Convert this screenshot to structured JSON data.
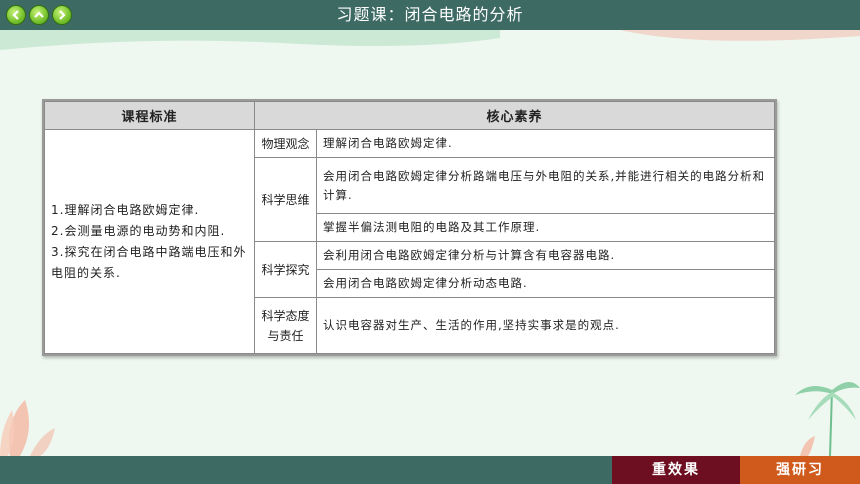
{
  "title": "习题课：闭合电路的分析",
  "colors": {
    "bar": "#3d6a63",
    "review": "#6d0f20",
    "train": "#cf5a1c",
    "nav": "#7bc531"
  },
  "table": {
    "headers": {
      "standard": "课程标准",
      "literacy": "核心素养"
    },
    "standards": [
      "1.理解闭合电路欧姆定律.",
      "2.会测量电源的电动势和内阻.",
      "3.探究在闭合电路中路端电压和外电阻的关系."
    ],
    "rows": [
      {
        "category": "物理观念",
        "text": "理解闭合电路欧姆定律."
      },
      {
        "category": "科学思维",
        "text": "会用闭合电路欧姆定律分析路端电压与外电阻的关系,并能进行相关的电路分析和计算."
      },
      {
        "category": "",
        "text": "掌握半偏法测电阻的电路及其工作原理."
      },
      {
        "category": "科学探究",
        "text": "会利用闭合电路欧姆定律分析与计算含有电容器电路."
      },
      {
        "category": "",
        "text": "会用闭合电路欧姆定律分析动态电路."
      },
      {
        "category": "科学态度与责任",
        "text": "认识电容器对生产、生活的作用,坚持实事求是的观点."
      }
    ]
  },
  "buttons": {
    "review": "重效果",
    "train": "强研习"
  }
}
